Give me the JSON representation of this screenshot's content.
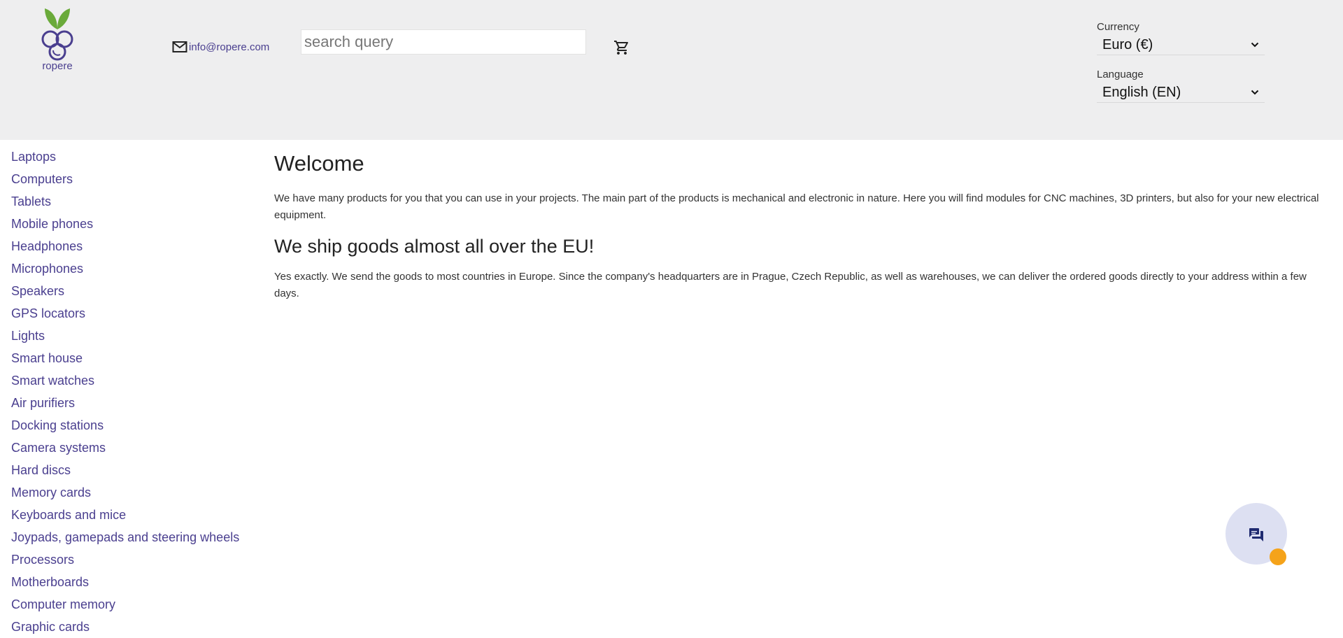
{
  "header": {
    "logo_text": "ropere",
    "email": "info@ropere.com",
    "search_placeholder": "search query",
    "search_value": "",
    "currency": {
      "label": "Currency",
      "value": "Euro (€)"
    },
    "language": {
      "label": "Language",
      "value": "English (EN)"
    }
  },
  "sidebar": {
    "items": [
      "Laptops",
      "Computers",
      "Tablets",
      "Mobile phones",
      "Headphones",
      "Microphones",
      "Speakers",
      "GPS locators",
      "Lights",
      "Smart house",
      "Smart watches",
      "Air purifiers",
      "Docking stations",
      "Camera systems",
      "Hard discs",
      "Memory cards",
      "Keyboards and mice",
      "Joypads, gamepads and steering wheels",
      "Processors",
      "Motherboards",
      "Computer memory",
      "Graphic cards"
    ]
  },
  "main": {
    "title": "Welcome",
    "intro": "We have many products for you that you can use in your projects. The main part of the products is mechanical and electronic in nature. Here you will find modules for CNC machines, 3D printers, but also for your new electrical equipment.",
    "shipping_title": "We ship goods almost all over the EU!",
    "shipping_text": "Yes exactly. We send the goods to most countries in Europe. Since the company's headquarters are in Prague, Czech Republic, as well as warehouses, we can deliver the ordered goods directly to your address within a few days."
  },
  "colors": {
    "brand": "#4a3f8f",
    "leaf": "#6aaa3a",
    "header_bg": "#eeeeef",
    "chat_bg": "#dde0f2",
    "chat_badge": "#f5a31a"
  },
  "icons": {
    "logo": "grape-logo-icon",
    "email": "mail-icon",
    "cart": "cart-icon",
    "chevron": "chevron-down-icon",
    "chat": "chat-icon"
  }
}
